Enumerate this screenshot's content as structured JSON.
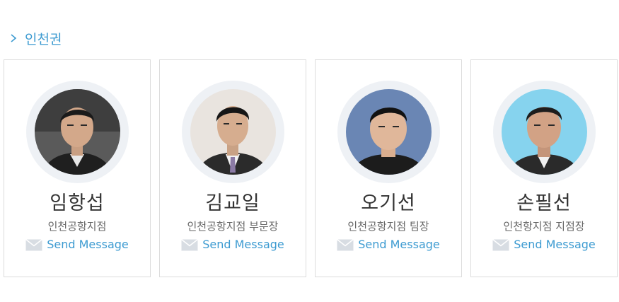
{
  "region": {
    "title": "인천권"
  },
  "colors": {
    "accent": "#3d9bd1",
    "ring": "#eef1f5",
    "border": "#dcdcdc"
  },
  "people": [
    {
      "name": "임항섭",
      "branch": "인천공항지점",
      "action": "Send Message"
    },
    {
      "name": "김교일",
      "branch": "인천공항지점 부문장",
      "action": "Send Message"
    },
    {
      "name": "오기선",
      "branch": "인천공항지점 팀장",
      "action": "Send Message"
    },
    {
      "name": "손필선",
      "branch": "인천항지점 지점장",
      "action": "Send Message"
    }
  ]
}
